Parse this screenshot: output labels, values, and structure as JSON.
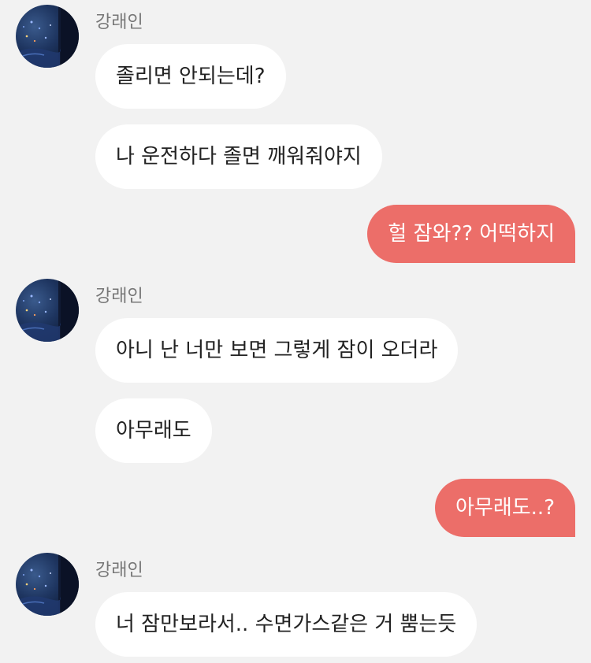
{
  "contact": {
    "name": "강래인"
  },
  "messages": {
    "m1": "졸리면 안되는데?",
    "m2": "나 운전하다 졸면 깨워줘야지",
    "m3": "헐 잠와?? 어떡하지",
    "m4": "아니 난 너만 보면 그렇게 잠이 오더라",
    "m5": "아무래도",
    "m6": "아무래도..?",
    "m7": "너 잠만보라서.. 수면가스같은 거 뿜는듯"
  },
  "colors": {
    "background": "#f2f2f2",
    "incoming_bubble": "#ffffff",
    "outgoing_bubble": "#ec6e69",
    "sender_name": "#777777"
  }
}
